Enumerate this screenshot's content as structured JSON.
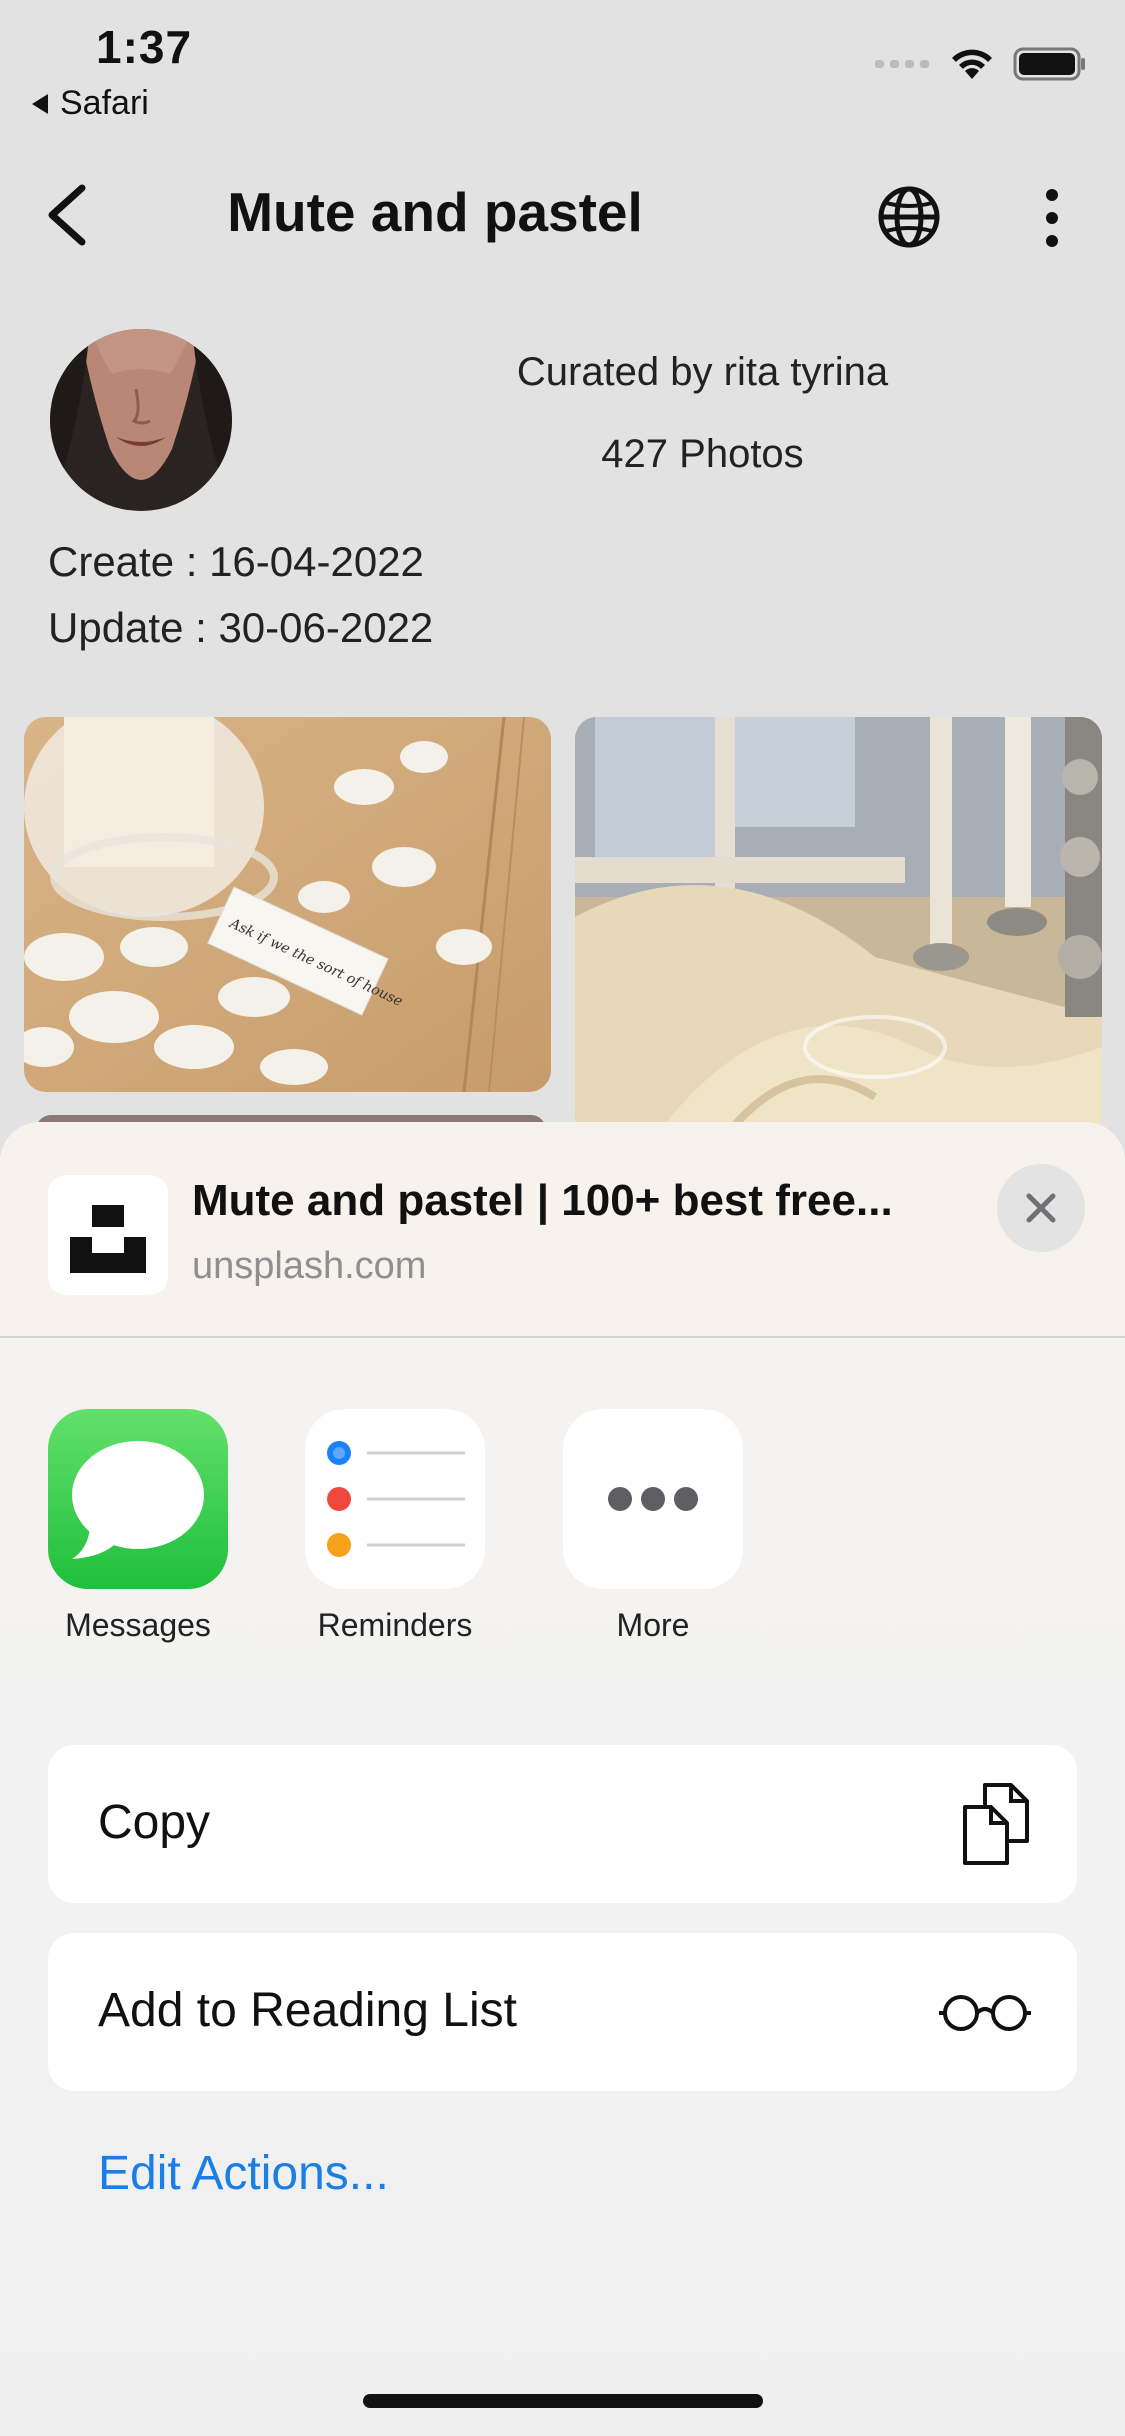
{
  "status_bar": {
    "time": "1:37",
    "back_app": "Safari",
    "icons": [
      "cellular-icon",
      "wifi-icon",
      "battery-icon"
    ]
  },
  "nav": {
    "title": "Mute and pastel",
    "icons": [
      "back-chevron-icon",
      "globe-icon",
      "more-vertical-icon"
    ]
  },
  "profile": {
    "curated_by": "Curated by rita tyrina",
    "photo_count": "427 Photos",
    "created": "Create : 16-04-2022",
    "updated": "Update : 30-06-2022"
  },
  "photos": [
    {
      "name": "photo-petals-jar",
      "handwriting": "Ask if we the sort of house"
    },
    {
      "name": "photo-candelabra"
    },
    {
      "name": "photo-partial"
    }
  ],
  "share_sheet": {
    "title": "Mute and pastel | 100+ best free...",
    "domain": "unsplash.com",
    "apps": [
      {
        "label": "Messages"
      },
      {
        "label": "Reminders"
      },
      {
        "label": "More"
      }
    ],
    "actions": [
      {
        "label": "Copy",
        "icon": "copy-icon"
      },
      {
        "label": "Add to Reading List",
        "icon": "glasses-icon"
      }
    ],
    "edit_actions": "Edit Actions..."
  },
  "colors": {
    "link_blue": "#1a7ee6",
    "messages_green": "#2ec84a",
    "reminder_blue": "#1a82fb",
    "reminder_red": "#f0473c",
    "reminder_orange": "#f7a21a"
  }
}
